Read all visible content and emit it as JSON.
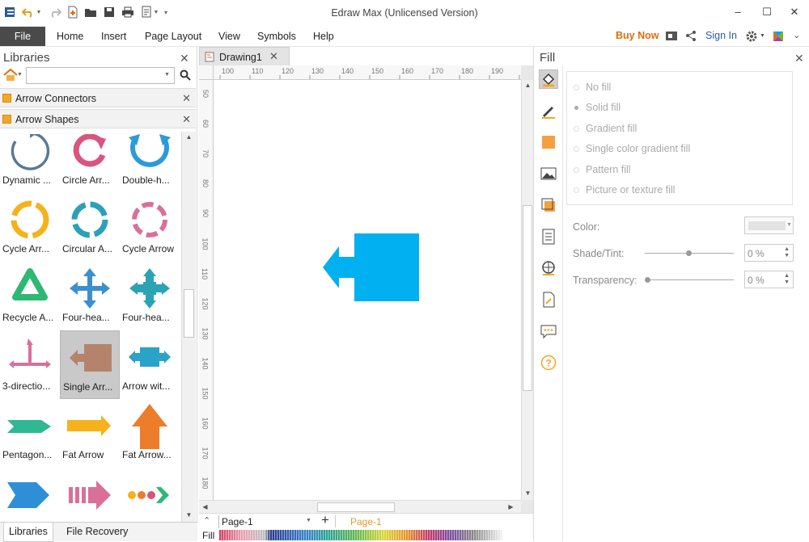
{
  "window": {
    "title": "Edraw Max (Unlicensed Version)"
  },
  "menu": {
    "file": "File",
    "items": [
      "Home",
      "Insert",
      "Page Layout",
      "View",
      "Symbols",
      "Help"
    ],
    "buy_now": "Buy Now",
    "sign_in": "Sign In"
  },
  "libraries": {
    "title": "Libraries",
    "search": {
      "value": "",
      "placeholder": ""
    },
    "sections": [
      "Arrow Connectors",
      "Arrow Shapes"
    ],
    "shapes": [
      "Dynamic ...",
      "Circle Arr...",
      "Double-h...",
      "Cycle Arr...",
      "Circular A...",
      "Cycle Arrow",
      "Recycle A...",
      "Four-hea...",
      "Four-hea...",
      "3-directio...",
      "Single Arr...",
      "Arrow wit...",
      "Pentagon...",
      "Fat Arrow",
      "Fat Arrow..."
    ],
    "selected_shape_index": 10,
    "bottom_tabs": [
      "Libraries",
      "File Recovery"
    ]
  },
  "document": {
    "tab": "Drawing1",
    "ruler_h": [
      "100",
      "110",
      "120",
      "130",
      "140",
      "150",
      "160",
      "170",
      "180",
      "190"
    ],
    "ruler_v": [
      "50",
      "60",
      "70",
      "80",
      "90",
      "100",
      "110",
      "120",
      "130",
      "140",
      "150",
      "160",
      "170",
      "180"
    ],
    "page_select": "Page-1",
    "page_tab": "Page-1",
    "fill_label": "Fill"
  },
  "fill_panel": {
    "title": "Fill",
    "options": [
      "No fill",
      "Solid fill",
      "Gradient fill",
      "Single color gradient fill",
      "Pattern fill",
      "Picture or texture fill"
    ],
    "selected_option": "Solid fill",
    "color_label": "Color:",
    "shade_label": "Shade/Tint:",
    "shade_value": "0 %",
    "transparency_label": "Transparency:",
    "transparency_value": "0 %"
  },
  "colors": {
    "shape_fill": "#00b0f0",
    "accent_orange": "#e36c09",
    "link_blue": "#2a5ca8"
  }
}
